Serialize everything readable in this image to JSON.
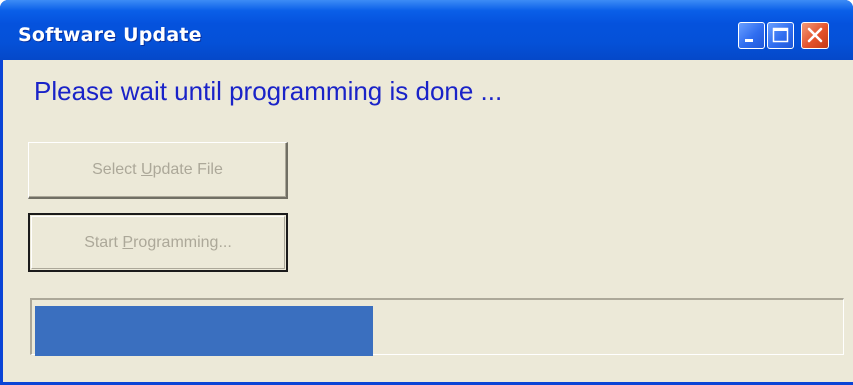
{
  "window": {
    "title": "Software Update",
    "controls": {
      "minimize_icon": "minimize-icon",
      "maximize_icon": "maximize-icon",
      "close_icon": "close-icon"
    }
  },
  "main": {
    "status_message": "Please wait until programming is done ...",
    "select_button": {
      "prefix": "Select ",
      "mnemonic": "U",
      "suffix": "pdate File"
    },
    "start_button": {
      "prefix": "Start ",
      "mnemonic": "P",
      "suffix": "rogramming..."
    },
    "progress": {
      "fraction": 0.42
    }
  },
  "colors": {
    "title_bar": "#0552dd",
    "status_text": "#1a23c8",
    "progress_fill": "#3a6fbf",
    "face": "#ece9d8",
    "disabled_text": "#aca899"
  }
}
